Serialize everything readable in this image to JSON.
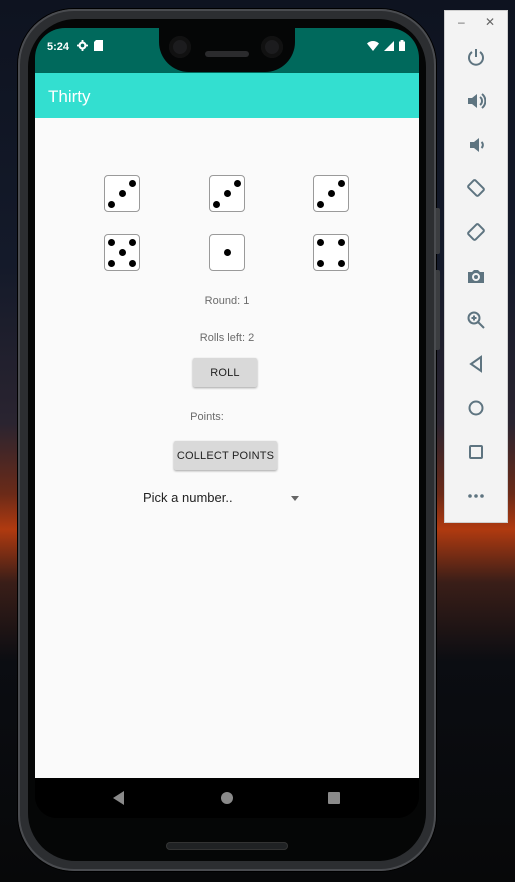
{
  "status": {
    "time": "5:24"
  },
  "app": {
    "title": "Thirty"
  },
  "dice": [
    {
      "value": 3,
      "row": 0,
      "col": 0
    },
    {
      "value": 3,
      "row": 0,
      "col": 1
    },
    {
      "value": 3,
      "row": 0,
      "col": 2
    },
    {
      "value": 5,
      "row": 1,
      "col": 0
    },
    {
      "value": 1,
      "row": 1,
      "col": 1
    },
    {
      "value": 4,
      "row": 1,
      "col": 2
    }
  ],
  "game": {
    "round_label": "Round: 1",
    "rolls_left_label": "Rolls left: 2",
    "roll_button": "ROLL",
    "points_label": "Points:",
    "collect_button": "COLLECT POINTS",
    "spinner_selected": "Pick a number.."
  },
  "toolbar": {
    "minimize": "–",
    "close": "✕",
    "buttons": [
      "power-icon",
      "volume-up-icon",
      "volume-down-icon",
      "rotate-left-icon",
      "rotate-right-icon",
      "camera-icon",
      "zoom-icon",
      "back-icon",
      "home-icon",
      "overview-icon",
      "more-icon"
    ]
  },
  "colors": {
    "status_bar": "#00695c",
    "app_bar": "#33dfd0",
    "content_bg": "#fafafa",
    "button_bg": "#d9d9d9",
    "toolbar_icon": "#5e7480"
  }
}
